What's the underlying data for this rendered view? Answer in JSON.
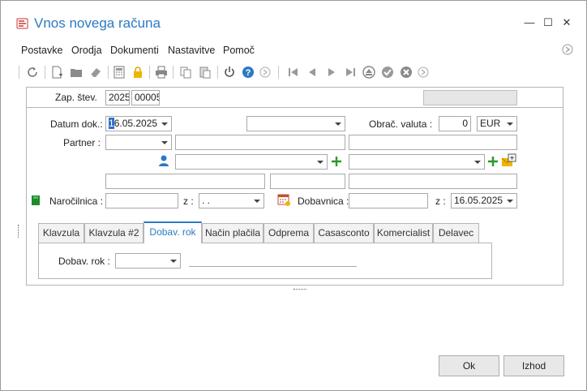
{
  "window": {
    "title": "Vnos novega računa",
    "controls": {
      "minimize": "—",
      "maximize": "☐",
      "close": "✕"
    }
  },
  "menu": {
    "items": [
      "Postavke",
      "Orodja",
      "Dokumenti",
      "Nastavitve",
      "Pomoč"
    ]
  },
  "toolbar": {
    "icons": [
      "refresh-icon",
      "new-document-icon",
      "open-folder-icon",
      "eraser-icon",
      "calculator-icon",
      "lock-icon",
      "print-icon",
      "copy-icon",
      "paste-icon",
      "power-icon",
      "help-icon",
      "forward-circle-icon",
      "first-record-icon",
      "previous-record-icon",
      "next-record-icon",
      "last-record-icon",
      "eject-icon",
      "confirm-icon",
      "cancel-icon",
      "forward-circle-icon"
    ]
  },
  "header": {
    "zap_label": "Zap. štev.",
    "year": "2025",
    "number": "00005",
    "right_field": ""
  },
  "form": {
    "datum_label": "Datum dok.:",
    "datum_value": "16.05.2025",
    "datum_cursor": "1",
    "datum_rest": "6.05.2025",
    "type_select": "",
    "valuta_label": "Obrač. valuta :",
    "rate_value": "0",
    "currency": "EUR",
    "partner_label": "Partner :",
    "partner_code": "",
    "partner_name": "",
    "partner_extra": "",
    "narocilnica_label": "Naročilnica :",
    "narocilnica_value": "",
    "narocilnica_z_label": "z :",
    "narocilnica_date": " .  .",
    "dobavnica_label": "Dobavnica :",
    "dobavnica_value": "",
    "dobavnica_z_label": "z :",
    "dobavnica_date": "16.05.2025"
  },
  "tabs": {
    "items": [
      "Klavzula",
      "Klavzula #2",
      "Dobav. rok",
      "Način plačila",
      "Odprema",
      "Casasconto",
      "Komercialist",
      "Delavec"
    ],
    "active_index": 2
  },
  "tab_content": {
    "dobav_rok_label": "Dobav. rok :",
    "dobav_rok_value": ""
  },
  "buttons": {
    "ok": "Ok",
    "exit": "Izhod"
  },
  "colors": {
    "accent": "#2b79c2",
    "green": "#2a9a2a",
    "contact_icon": "#2b79c2"
  }
}
